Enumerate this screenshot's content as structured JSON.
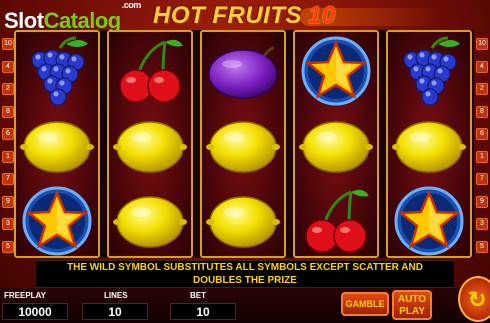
{
  "watermark": {
    "part1": "Slot",
    "part2": "Catalog",
    "suffix": ".com"
  },
  "game": {
    "title": "HOT FRUITS",
    "number": "10"
  },
  "paylines": {
    "left": [
      "10",
      "4",
      "2",
      "8",
      "6",
      "1",
      "7",
      "9",
      "3",
      "5"
    ],
    "right": [
      "10",
      "4",
      "2",
      "8",
      "6",
      "1",
      "7",
      "9",
      "3",
      "5"
    ]
  },
  "reels": [
    [
      "grapes",
      "lemon",
      "star"
    ],
    [
      "cherries",
      "lemon",
      "lemon"
    ],
    [
      "plum",
      "lemon",
      "lemon"
    ],
    [
      "star",
      "lemon",
      "cherries"
    ],
    [
      "grapes",
      "lemon",
      "star"
    ]
  ],
  "info_message": {
    "line1": "THE WILD SYMBOL SUBSTITUTES ALL SYMBOLS EXCEPT SCATTER AND",
    "line2": "DOUBLES THE PRIZE"
  },
  "panel": {
    "freeplay_label": "FREEPLAY",
    "freeplay_value": "10000",
    "lines_label": "LINES",
    "lines_value": "10",
    "bet_label": "BET",
    "bet_value": "10",
    "gamble_label": "GAMBLE",
    "autoplay_line1": "AUTO",
    "autoplay_line2": "PLAY",
    "spin_icon": "spin-arrows-icon"
  },
  "colors": {
    "accent": "#ffd200",
    "background": "#6e0c06",
    "frame": "#d8a01a"
  }
}
